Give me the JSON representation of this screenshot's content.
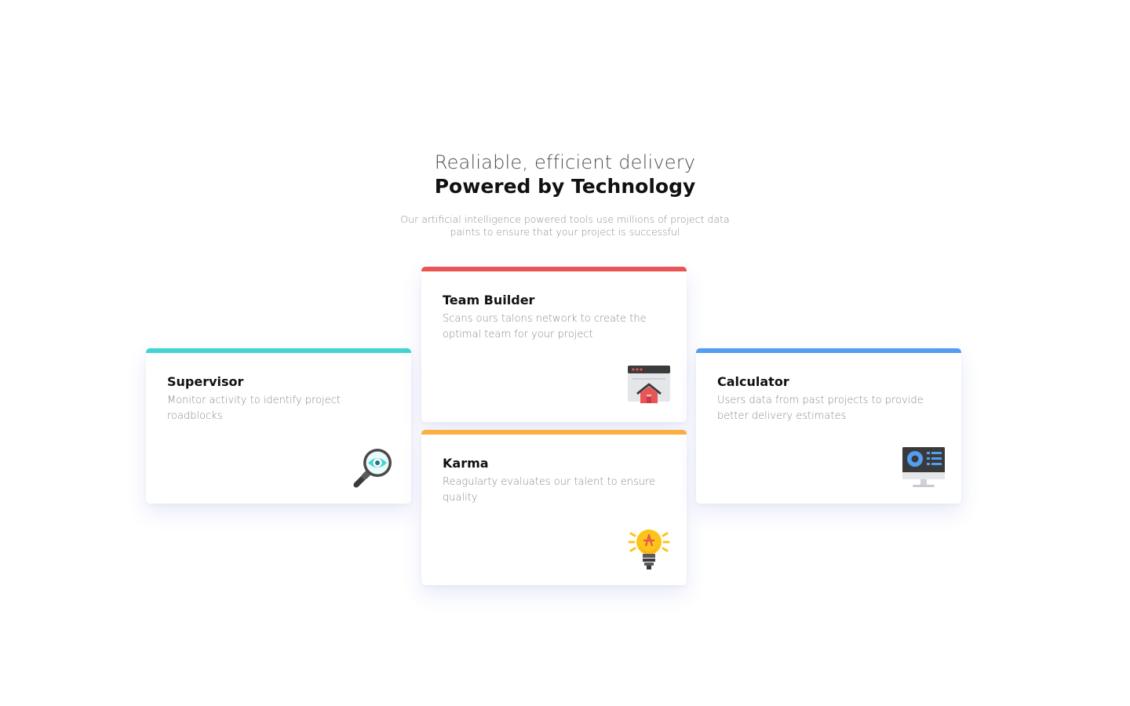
{
  "hero": {
    "subtitle": "Realiable, efficient delivery",
    "title": "Powered by Technology",
    "description": "Our artificial intelligence powered tools use millions of project data paints to ensure that your project is successful"
  },
  "cards": {
    "supervisor": {
      "title": "Supervisor",
      "description": "Monitor activity to identify project roadblocks",
      "accent": "#44d3d2",
      "icon": "magnifier-eye-icon"
    },
    "team_builder": {
      "title": "Team Builder",
      "description": "Scans ours talons network to create the optimal team for your project",
      "accent": "#ea5454",
      "icon": "browser-home-icon"
    },
    "karma": {
      "title": "Karma",
      "description": "Reagularty evaluates our talent to ensure quality",
      "accent": "#fcaf41",
      "icon": "lightbulb-icon"
    },
    "calculator": {
      "title": "Calculator",
      "description": "Users data from past projects to provide better delivery estimates",
      "accent": "#549ef2",
      "icon": "monitor-dashboard-icon"
    }
  }
}
